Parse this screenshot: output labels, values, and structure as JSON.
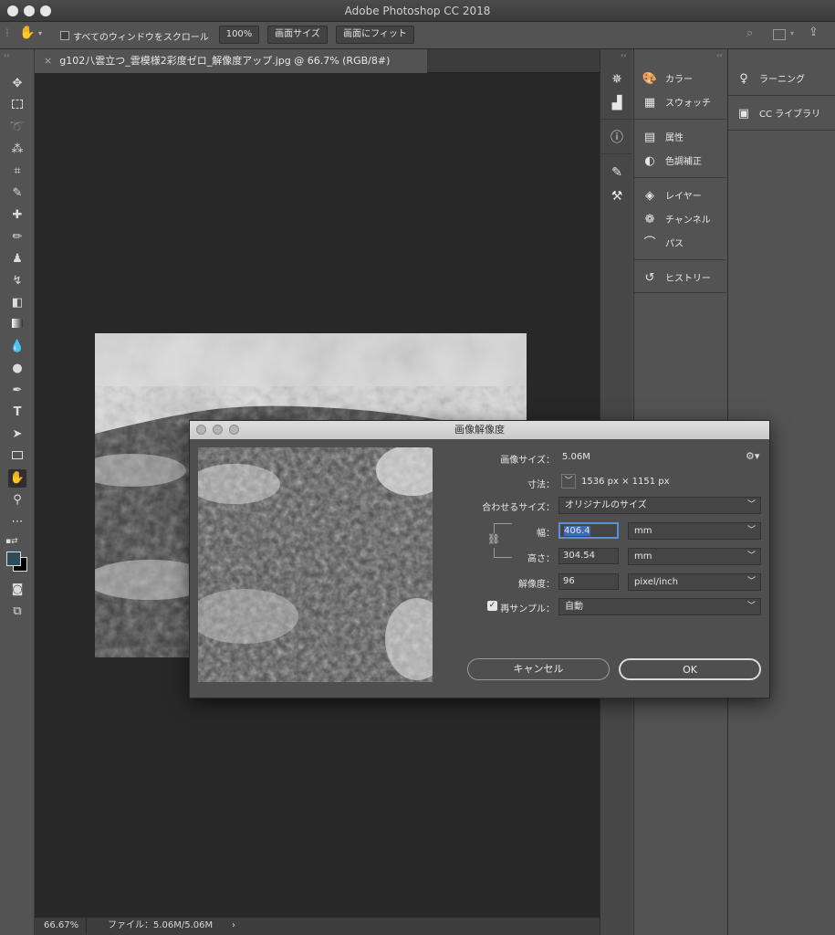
{
  "window": {
    "title": "Adobe Photoshop CC 2018"
  },
  "options": {
    "scroll_all_label": "すべてのウィンドウをスクロール",
    "zoom_btn": "100%",
    "fit_screen_btn": "画面サイズ",
    "fill_screen_btn": "画面にフィット"
  },
  "document": {
    "tab_title": "g102八雲立つ_雲模様2彩度ゼロ_解像度アップ.jpg @ 66.7% (RGB/8#)",
    "tab_close": "×"
  },
  "status": {
    "zoom": "66.67%",
    "file": "ファイル：5.06M/5.06M",
    "arrow": "›"
  },
  "panels": {
    "column2": [
      "カラー",
      "スウォッチ",
      "属性",
      "色調補正",
      "レイヤー",
      "チャンネル",
      "パス",
      "ヒストリー"
    ],
    "column3": [
      "ラーニング",
      "CC ライブラリ"
    ]
  },
  "dialog": {
    "title": "画像解像度",
    "image_size_label": "画像サイズ：",
    "image_size_value": "5.06M",
    "dimensions_label": "寸法：",
    "dimensions_value": "1536 px × 1151 px",
    "fit_label": "合わせるサイズ：",
    "fit_value": "オリジナルのサイズ",
    "width_label": "幅：",
    "width_value": "406.4",
    "width_unit": "mm",
    "height_label": "高さ：",
    "height_value": "304.54",
    "height_unit": "mm",
    "res_label": "解像度：",
    "res_value": "96",
    "res_unit": "pixel/inch",
    "resample_label": "再サンプル：",
    "resample_value": "自動",
    "cancel": "キャンセル",
    "ok": "OK"
  }
}
